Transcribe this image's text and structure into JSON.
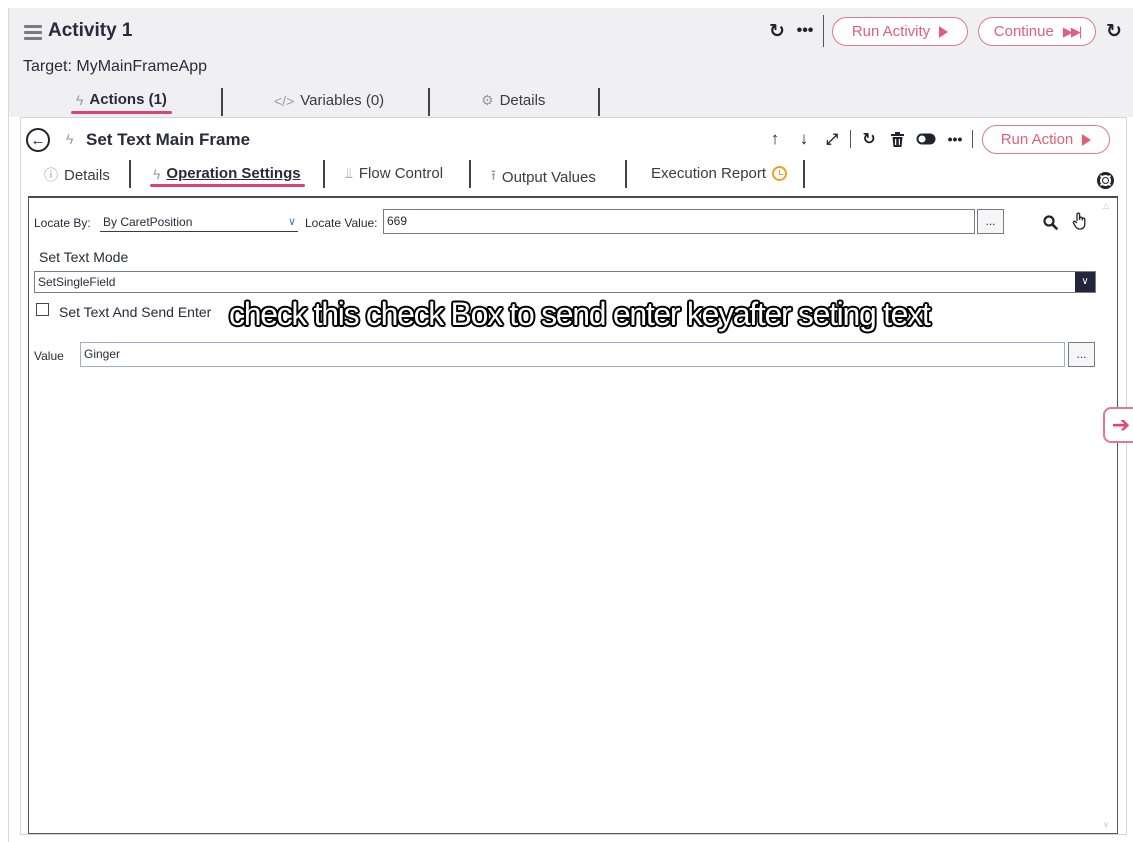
{
  "activity": {
    "title": "Activity 1",
    "target_label": "Target: MyMainFrameApp",
    "run_activity_label": "Run Activity",
    "continue_label": "Continue"
  },
  "top_tabs": [
    {
      "label": "Actions (1)",
      "icon": "lightning-icon",
      "active": true
    },
    {
      "label": "Variables (0)",
      "icon": "code-icon",
      "active": false
    },
    {
      "label": "Details",
      "icon": "gear-icon",
      "active": false
    }
  ],
  "action": {
    "name": "Set Text Main Frame",
    "run_action_label": "Run Action"
  },
  "action_tabs": [
    {
      "label": "Details",
      "icon": "info-icon",
      "active": false
    },
    {
      "label": "Operation Settings",
      "icon": "lightning-icon",
      "active": true
    },
    {
      "label": "Flow Control",
      "icon": "signpost-icon",
      "active": false
    },
    {
      "label": "Output Values",
      "icon": "upload-icon",
      "active": false
    },
    {
      "label": "Execution Report",
      "icon": "clock-icon",
      "active": false
    }
  ],
  "form": {
    "locate_by_label": "Locate By:",
    "locate_by_value": "By CaretPosition",
    "locate_value_label": "Locate Value:",
    "locate_value": "669",
    "dots": "...",
    "set_text_mode_label": "Set Text Mode",
    "set_text_mode_value": "SetSingleField",
    "checkbox_label": "Set Text And Send Enter",
    "checkbox_checked": false,
    "value_label": "Value",
    "value": "Ginger"
  },
  "overlay_caption": "check this check Box to send enter keyafter seting text",
  "colors": {
    "accent": "#e0607a",
    "underline": "#d6457a",
    "clock": "#f0a020"
  }
}
